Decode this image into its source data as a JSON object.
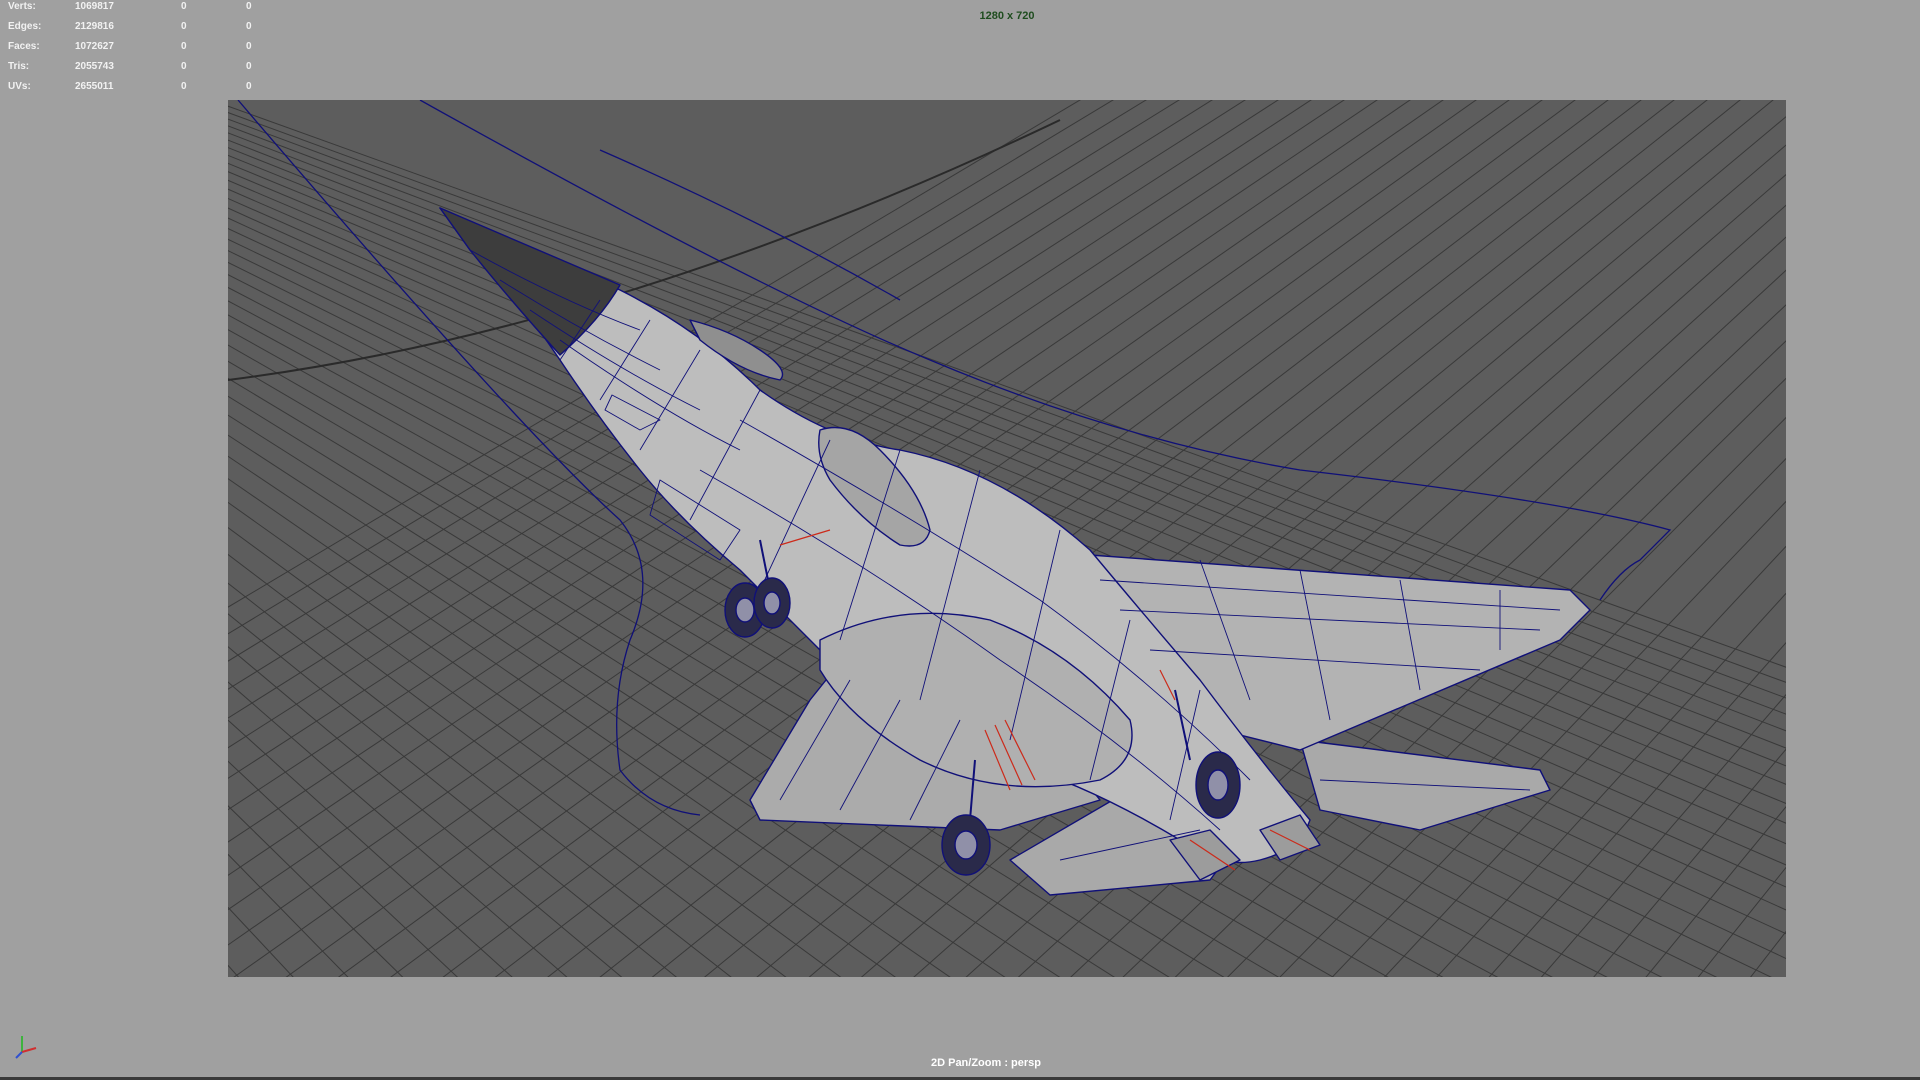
{
  "hud": {
    "rows": [
      {
        "label": "Verts:",
        "total": "1069817",
        "selected": "0",
        "component": "0"
      },
      {
        "label": "Edges:",
        "total": "2129816",
        "selected": "0",
        "component": "0"
      },
      {
        "label": "Faces:",
        "total": "1072627",
        "selected": "0",
        "component": "0"
      },
      {
        "label": "Tris:",
        "total": "2055743",
        "selected": "0",
        "component": "0"
      },
      {
        "label": "UVs:",
        "total": "2655011",
        "selected": "0",
        "component": "0"
      }
    ]
  },
  "resolution_text": "1280 x 720",
  "status_text": "2D Pan/Zoom : persp",
  "colors": {
    "viewport_bg": "#a0a0a0",
    "gate_bg": "#5d5d5d",
    "grid": "#2e2e2e",
    "wireframe": "#101078",
    "selection": "#cc2a1a",
    "mesh_fill": "#b9b9b9",
    "resolution_text": "#1f4d1f"
  },
  "icons": {
    "axis_gizmo": "xyz-axis-icon"
  }
}
